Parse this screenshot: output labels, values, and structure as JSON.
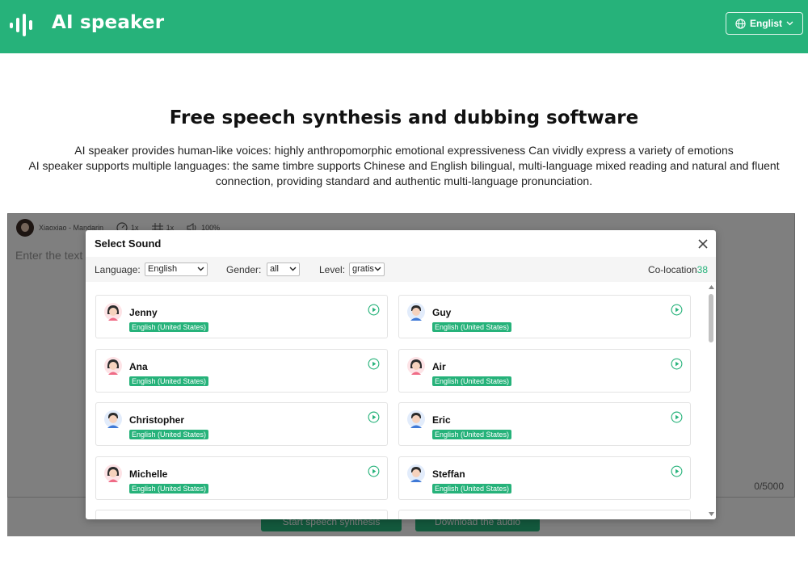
{
  "header": {
    "app_name": "AI speaker",
    "language_button": "Englist",
    "brand_color": "#26b27a"
  },
  "hero": {
    "title": "Free speech synthesis and dubbing software",
    "line1": "AI speaker provides human-like voices: highly anthropomorphic emotional expressiveness Can vividly express a variety of emotions",
    "line2": "AI speaker supports multiple languages: the same timbre supports Chinese and English bilingual, multi-language mixed reading and natural and fluent connection, providing standard and authentic multi-language pronunciation."
  },
  "editor": {
    "voice_name": "Xiaoxiao - Mandarin",
    "speed": "1x",
    "pitch": "1x",
    "volume": "100%",
    "placeholder": "Enter the text y",
    "char_count": "0/5000",
    "btn_synthesize": "Start speech synthesis",
    "btn_download": "Download the audio"
  },
  "modal": {
    "title": "Select Sound",
    "filters": {
      "language_label": "Language:",
      "language_value": "English",
      "gender_label": "Gender:",
      "gender_value": "all",
      "level_label": "Level:",
      "level_value": "gratis",
      "colocation_label": "Co-location",
      "colocation_count": "38"
    },
    "voices": [
      {
        "name": "Jenny",
        "tag": "English (United States)",
        "gender": "female",
        "icon": "female-avatar-icon"
      },
      {
        "name": "Guy",
        "tag": "English (United States)",
        "gender": "male",
        "icon": "male-avatar-icon"
      },
      {
        "name": "Ana",
        "tag": "English (United States)",
        "gender": "female",
        "icon": "female-avatar-icon"
      },
      {
        "name": "Air",
        "tag": "English (United States)",
        "gender": "female",
        "icon": "female-avatar-icon"
      },
      {
        "name": "Christopher",
        "tag": "English (United States)",
        "gender": "male",
        "icon": "male-avatar-icon"
      },
      {
        "name": "Eric",
        "tag": "English (United States)",
        "gender": "male",
        "icon": "male-avatar-icon"
      },
      {
        "name": "Michelle",
        "tag": "English (United States)",
        "gender": "female",
        "icon": "female-avatar-icon"
      },
      {
        "name": "Steffan",
        "tag": "English (United States)",
        "gender": "male",
        "icon": "male-avatar-icon"
      }
    ]
  }
}
